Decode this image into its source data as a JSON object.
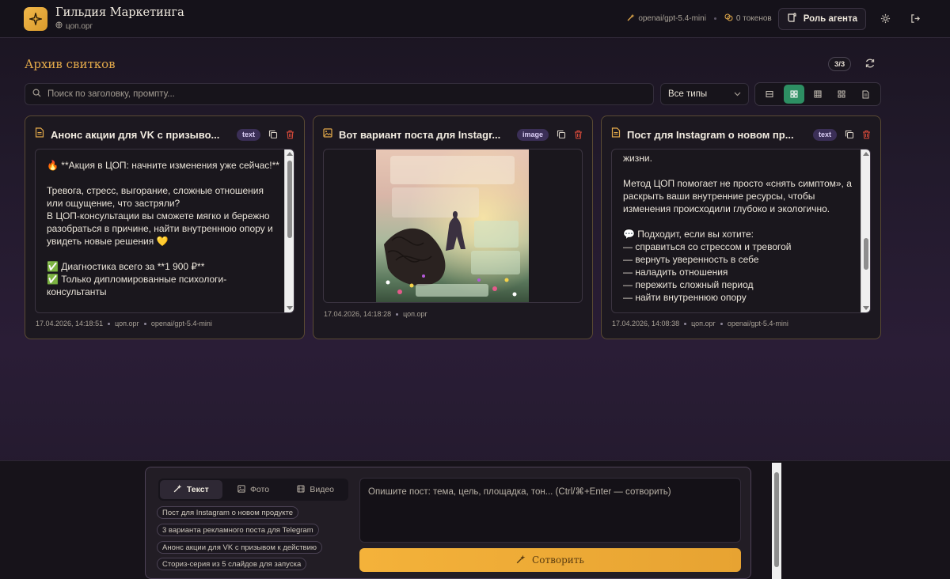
{
  "header": {
    "brand_title": "Гильдия Маркетинга",
    "brand_domain": "цоп.орг",
    "model": "openai/gpt-5.4-mini",
    "tokens": "0 токенов",
    "role_button": "Роль агента"
  },
  "archive": {
    "title": "Архив свитков",
    "count": "3/3",
    "search_placeholder": "Поиск по заголовку, промпту...",
    "type_filter": "Все типы"
  },
  "cards": [
    {
      "title": "Анонс акции для VK с призыво...",
      "type": "text",
      "body": "🔥 **Акция в ЦОП: начните изменения уже сейчас!**\n\nТревога, стресс, выгорание, сложные отношения или ощущение, что застряли?\nВ ЦОП-консультации вы сможете мягко и бережно разобраться в причине, найти внутреннюю опору и увидеть новые решения 💛\n\n✅ Диагностика всего за **1 900 ₽**\n✅ Только дипломированные психологи-консультанты",
      "date": "17.04.2026, 14:18:51",
      "domain": "цоп.орг",
      "model": "openai/gpt-5.4-mini"
    },
    {
      "title": "Вот вариант поста для Instagr...",
      "type": "image",
      "image_caption": "Новый продукт на цоп.орг — ваш первый шаг к внутренним изменениям",
      "date": "17.04.2026, 14:18:28",
      "domain": "цоп.орг"
    },
    {
      "title": "Пост для Instagram о новом пр...",
      "type": "text",
      "body": "жизни.\n\nМетод ЦОП помогает не просто «снять симптом», а раскрыть ваши внутренние ресурсы, чтобы изменения происходили глубоко и экологично.\n\n💬 Подходит, если вы хотите:\n— справиться со стрессом и тревогой\n— вернуть уверенность в себе\n— наладить отношения\n— пережить сложный период\n— найти внутреннюю опору",
      "date": "17.04.2026, 14:08:38",
      "domain": "цоп.орг",
      "model": "openai/gpt-5.4-mini"
    }
  ],
  "composer": {
    "tabs": [
      "Текст",
      "Фото",
      "Видео"
    ],
    "active_tab": "Текст",
    "suggestions": [
      "Пост для Instagram о новом продукте",
      "3 варианта рекламного поста для Telegram",
      "Анонс акции для VK с призывом к действию",
      "Сториз-серия из 5 слайдов для запуска"
    ],
    "prompt_placeholder": "Опишите пост: тема, цель, площадка, тон...  (Ctrl/⌘+Enter — сотворить)",
    "create_button": "Сотворить"
  },
  "colors": {
    "accent": "#e2a94a",
    "active_view": "#2d8f63",
    "badge": "#3b2f57",
    "delete": "#d94a3a"
  }
}
